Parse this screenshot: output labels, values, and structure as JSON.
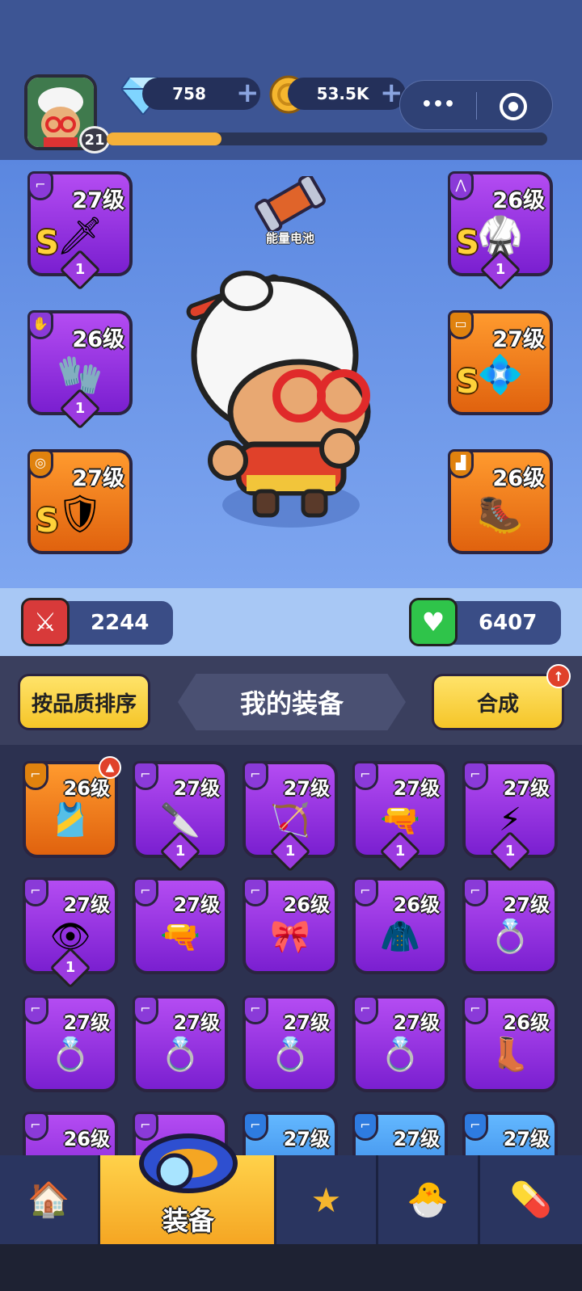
{
  "header": {
    "gems": "758",
    "gold": "53.5K",
    "player_level": "21",
    "xp_fraction": 0.26,
    "menu_dots": "•••",
    "record_icon": "target-icon"
  },
  "battery": {
    "label": "能量电池"
  },
  "hero_slots": [
    {
      "id": "weapon",
      "level": "27级",
      "grade": "S",
      "stars": "1",
      "rarity": "purple",
      "type_icon": "gun-icon"
    },
    {
      "id": "armor",
      "level": "26级",
      "grade": "S",
      "stars": "1",
      "rarity": "purple",
      "type_icon": "vest-icon"
    },
    {
      "id": "gloves",
      "level": "26级",
      "grade": "",
      "stars": "1",
      "rarity": "purple",
      "type_icon": "hand-icon"
    },
    {
      "id": "belt",
      "level": "27级",
      "grade": "S",
      "stars": "",
      "rarity": "orange",
      "type_icon": "belt-icon"
    },
    {
      "id": "ring",
      "level": "27级",
      "grade": "S",
      "stars": "",
      "rarity": "orange",
      "type_icon": "ring-icon"
    },
    {
      "id": "boots",
      "level": "26级",
      "grade": "",
      "stars": "",
      "rarity": "orange",
      "type_icon": "boot-icon"
    }
  ],
  "stats": {
    "attack": "2244",
    "health": "6407"
  },
  "panel": {
    "sort_label": "按品质排序",
    "title": "我的装备",
    "merge_label": "合成"
  },
  "inventory": [
    {
      "level": "26级",
      "rarity": "orange",
      "stars": "",
      "art": "🎽",
      "badge": true
    },
    {
      "level": "27级",
      "rarity": "purple",
      "stars": "1",
      "art": "🔪"
    },
    {
      "level": "27级",
      "rarity": "purple",
      "stars": "1",
      "art": "🏹"
    },
    {
      "level": "27级",
      "rarity": "purple",
      "stars": "1",
      "art": "🔫"
    },
    {
      "level": "27级",
      "rarity": "purple",
      "stars": "1",
      "art": "⚡"
    },
    {
      "level": "27级",
      "rarity": "purple",
      "stars": "1",
      "art": "👁"
    },
    {
      "level": "27级",
      "rarity": "purple",
      "stars": "",
      "art": "🔫"
    },
    {
      "level": "26级",
      "rarity": "purple",
      "stars": "",
      "art": "🎀"
    },
    {
      "level": "26级",
      "rarity": "purple",
      "stars": "",
      "art": "🧥"
    },
    {
      "level": "27级",
      "rarity": "purple",
      "stars": "",
      "art": "💍"
    },
    {
      "level": "27级",
      "rarity": "purple",
      "stars": "",
      "art": "💍"
    },
    {
      "level": "27级",
      "rarity": "purple",
      "stars": "",
      "art": "💍"
    },
    {
      "level": "27级",
      "rarity": "purple",
      "stars": "",
      "art": "💍"
    },
    {
      "level": "27级",
      "rarity": "purple",
      "stars": "",
      "art": "💍"
    },
    {
      "level": "26级",
      "rarity": "purple",
      "stars": "",
      "art": "👢"
    },
    {
      "level": "26级",
      "rarity": "purple",
      "stars": "",
      "art": ""
    },
    {
      "level": "",
      "rarity": "purple",
      "stars": "",
      "art": ""
    },
    {
      "level": "27级",
      "rarity": "blue",
      "stars": "",
      "art": ""
    },
    {
      "level": "27级",
      "rarity": "blue",
      "stars": "",
      "art": ""
    },
    {
      "level": "27级",
      "rarity": "blue",
      "stars": "",
      "art": ""
    }
  ],
  "nav": {
    "active_label": "装备",
    "items": [
      "shop-icon",
      "equipment-icon",
      "star-icon",
      "pet-icon",
      "capsule-icon"
    ]
  }
}
